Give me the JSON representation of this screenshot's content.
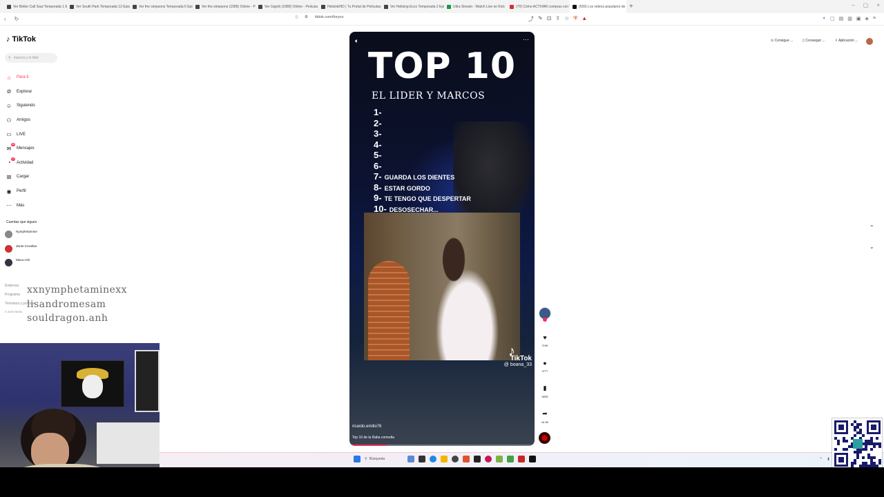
{
  "browser": {
    "tabs": [
      {
        "title": "Ver Better Call Saul Temporada 1 Ep"
      },
      {
        "title": "Ver South Park Temporada 12 Episo"
      },
      {
        "title": "Ver the simpsons Temporada 6 Episo"
      },
      {
        "title": "Ver the simpsons (1989) Online - Pe"
      },
      {
        "title": "Ver Gigolò (1980) Online - Pelicula"
      },
      {
        "title": "HelsinkiHD | Tu Portal de Películas y"
      },
      {
        "title": "Ver Hellsing Ecco Temporada 2 Epis"
      },
      {
        "title": "Ultra Stream - Watch Live on Kick"
      },
      {
        "title": "(70) Cómo ACTIVAR compras con Vi"
      },
      {
        "title": "(559) Los videos populares de"
      }
    ],
    "active_tab_index": 9,
    "url": "tiktok.com/foryou",
    "new_tab_symbol": "+"
  },
  "sidebar": {
    "logo": "TikTok",
    "search_placeholder": "marcos y el lider",
    "items": [
      {
        "label": "Para ti",
        "icon": "home-icon",
        "active": true
      },
      {
        "label": "Explorar",
        "icon": "compass-icon"
      },
      {
        "label": "Siguiendo",
        "icon": "following-icon"
      },
      {
        "label": "Amigos",
        "icon": "friends-icon"
      },
      {
        "label": "LIVE",
        "icon": "live-icon"
      },
      {
        "label": "Mensajes",
        "icon": "message-icon",
        "badge": "46"
      },
      {
        "label": "Actividad",
        "icon": "bell-icon",
        "badge": "14"
      },
      {
        "label": "Cargar",
        "icon": "upload-icon"
      },
      {
        "label": "Perfil",
        "icon": "profile-icon"
      },
      {
        "label": "Más",
        "icon": "more-icon"
      }
    ],
    "following_header": "Cuentas que sigues",
    "accounts": [
      {
        "name": "Nymphetamine",
        "handle": "xxnymphetaminexx"
      },
      {
        "name": "dante Cevallos",
        "handle": "lisandromesam"
      },
      {
        "name": "Maca Ash",
        "handle": "souldragon.anh"
      }
    ],
    "footer": [
      "Empresa",
      "Programa",
      "Términos y políticas",
      "© 2025 TikTok"
    ]
  },
  "video": {
    "title_big": "TOP 10",
    "subtitle": "EL LIDER Y MARCOS",
    "ranking": [
      {
        "n": "1-",
        "text": ""
      },
      {
        "n": "2-",
        "text": ""
      },
      {
        "n": "3-",
        "text": ""
      },
      {
        "n": "4-",
        "text": ""
      },
      {
        "n": "5-",
        "text": ""
      },
      {
        "n": "6-",
        "text": ""
      },
      {
        "n": "7-",
        "text": "GUARDA LOS DIENTES"
      },
      {
        "n": "8-",
        "text": "ESTAR GORDO"
      },
      {
        "n": "9-",
        "text": "TE TENGO QUE DESPERTAR"
      },
      {
        "n": "10-",
        "text": "DESOSECHAR..."
      }
    ],
    "watermark_name": "TikTok",
    "watermark_handle": "@ boana_33",
    "author": "ricardo.emilio76",
    "description": "Top 10 de la Raba comedia",
    "progress": 0.2
  },
  "actions": {
    "likes": "719K",
    "comments": "3777",
    "saves": "6635",
    "shares": "16.3K"
  },
  "topright": {
    "links": [
      "Consigue ...",
      "Conseguir ...",
      "Aplicación ..."
    ]
  },
  "taskbar": {
    "search_label": "Búsqueda"
  }
}
